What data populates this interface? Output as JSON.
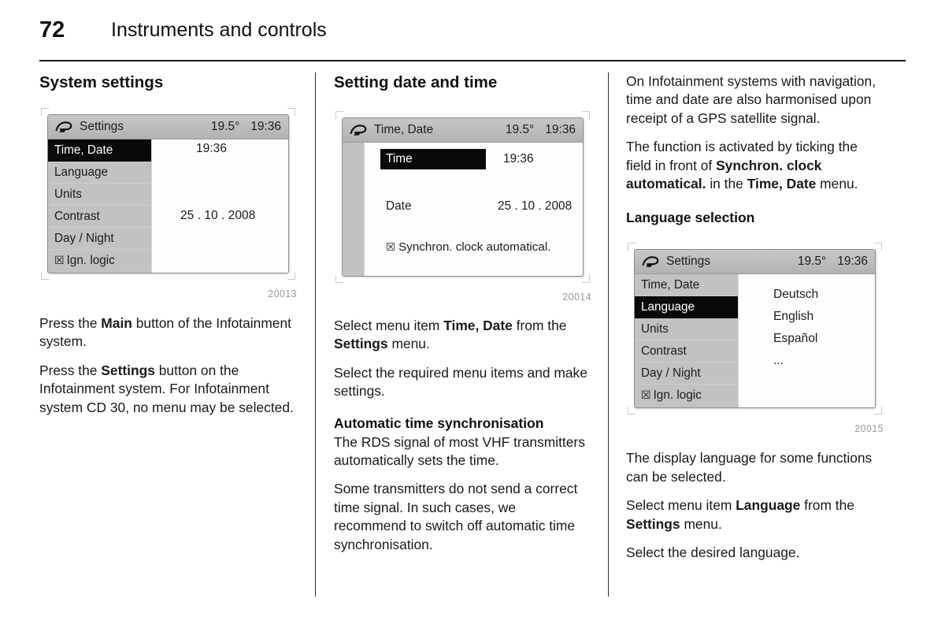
{
  "header": {
    "page_number": "72",
    "title": "Instruments and controls"
  },
  "columns": {
    "left": {
      "section_title": "System settings",
      "figure_id": "20013",
      "paragraphs": [
        {
          "runs": [
            {
              "t": "Press the ",
              "b": false
            },
            {
              "t": "Main",
              "b": true
            },
            {
              "t": " button of the Infotainment system.",
              "b": false
            }
          ]
        },
        {
          "runs": [
            {
              "t": "Press the ",
              "b": false
            },
            {
              "t": "Settings",
              "b": true
            },
            {
              "t": " button on the Infotainment system. For Infotainment system CD 30, no menu may be selected.",
              "b": false
            }
          ]
        }
      ],
      "display": {
        "header": {
          "icon": "settings-wrench-icon",
          "title": "Settings",
          "temperature": "19.5°",
          "clock": "19:36"
        },
        "menu_items": [
          {
            "label": "Time, Date",
            "selected": true,
            "checkbox": false
          },
          {
            "label": "Language",
            "selected": false,
            "checkbox": false
          },
          {
            "label": "Units",
            "selected": false,
            "checkbox": false
          },
          {
            "label": "Contrast",
            "selected": false,
            "checkbox": false
          },
          {
            "label": "Day / Night",
            "selected": false,
            "checkbox": false
          },
          {
            "label": "Ign. logic",
            "selected": false,
            "checkbox": true
          }
        ],
        "value_time": "19:36",
        "value_date": "25 . 10 . 2008"
      }
    },
    "middle": {
      "section_title": "Setting date and time",
      "figure_id": "20014",
      "sub_title": "Automatic time synchronisation",
      "paragraphs": [
        {
          "runs": [
            {
              "t": "Select menu item ",
              "b": false
            },
            {
              "t": "Time, Date",
              "b": true
            },
            {
              "t": " from the ",
              "b": false
            },
            {
              "t": "Settings",
              "b": true
            },
            {
              "t": " menu.",
              "b": false
            }
          ]
        },
        {
          "runs": [
            {
              "t": "Select the required menu items and make settings.",
              "b": false
            }
          ]
        }
      ],
      "paragraphs_after_sub": [
        {
          "runs": [
            {
              "t": "The RDS signal of most VHF transmitters automatically sets the time.",
              "b": false
            }
          ]
        },
        {
          "runs": [
            {
              "t": "Some transmitters do not send a correct time signal. In such cases, we recommend to switch off automatic time synchronisation.",
              "b": false
            }
          ]
        }
      ],
      "display": {
        "header": {
          "icon": "settings-wrench-icon",
          "title": "Time, Date",
          "temperature": "19.5°",
          "clock": "19:36"
        },
        "rows": [
          {
            "label": "Time",
            "value": "19:36",
            "selected": true
          },
          {
            "label": "Date",
            "value": "25 . 10 . 2008",
            "selected": false
          }
        ],
        "sync_checkbox": "☒",
        "sync_label": "Synchron. clock automatical."
      }
    },
    "right": {
      "figure_id": "20015",
      "sub_title": "Language selection",
      "paragraphs_top": [
        {
          "runs": [
            {
              "t": "On Infotainment systems with navigation, time and date are also harmonised upon receipt of a GPS satellite signal.",
              "b": false
            }
          ]
        },
        {
          "runs": [
            {
              "t": "The function is activated by ticking the field in front of ",
              "b": false
            },
            {
              "t": "Synchron. clock automatical.",
              "b": true
            },
            {
              "t": " in the ",
              "b": false
            },
            {
              "t": "Time, Date",
              "b": true
            },
            {
              "t": " menu.",
              "b": false
            }
          ]
        }
      ],
      "paragraphs_bottom": [
        {
          "runs": [
            {
              "t": "The display language for some functions can be selected.",
              "b": false
            }
          ]
        },
        {
          "runs": [
            {
              "t": "Select menu item ",
              "b": false
            },
            {
              "t": "Language",
              "b": true
            },
            {
              "t": " from the ",
              "b": false
            },
            {
              "t": "Settings",
              "b": true
            },
            {
              "t": " menu.",
              "b": false
            }
          ]
        },
        {
          "runs": [
            {
              "t": "Select the desired language.",
              "b": false
            }
          ]
        }
      ],
      "display": {
        "header": {
          "icon": "settings-wrench-icon",
          "title": "Settings",
          "temperature": "19.5°",
          "clock": "19:36"
        },
        "menu_items": [
          {
            "label": "Time, Date",
            "selected": false,
            "checkbox": false
          },
          {
            "label": "Language",
            "selected": true,
            "checkbox": false
          },
          {
            "label": "Units",
            "selected": false,
            "checkbox": false
          },
          {
            "label": "Contrast",
            "selected": false,
            "checkbox": false
          },
          {
            "label": "Day / Night",
            "selected": false,
            "checkbox": false
          },
          {
            "label": "Ign. logic",
            "selected": false,
            "checkbox": true
          }
        ],
        "languages": [
          "Deutsch",
          "English",
          "Español",
          "..."
        ]
      }
    }
  },
  "colors": {
    "display_header_gray": "#bdbdbd",
    "menu_gray": "#c2c2c2",
    "selected_black": "#0a0a0a",
    "screen_white": "#fdfdfd",
    "figure_id_gray": "#9a9a9a"
  },
  "checkbox_glyph": "☒"
}
